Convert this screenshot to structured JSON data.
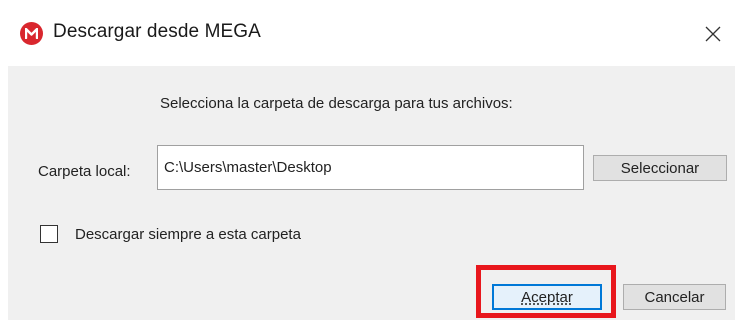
{
  "window": {
    "title": "Descargar desde MEGA",
    "icon": "mega-logo-icon",
    "close_glyph": "✕",
    "brand_color": "#d9272e"
  },
  "dialog": {
    "prompt": "Selecciona la carpeta de descarga para tus archivos:",
    "local_folder_label": "Carpeta local:",
    "local_folder_value": "C:\\Users\\master\\Desktop",
    "select_button_label": "Seleccionar",
    "always_checkbox_label": "Descargar siempre a esta carpeta",
    "always_checkbox_checked": false,
    "accept_button_label": "Aceptar",
    "cancel_button_label": "Cancelar",
    "highlight_color": "#e8161c"
  }
}
